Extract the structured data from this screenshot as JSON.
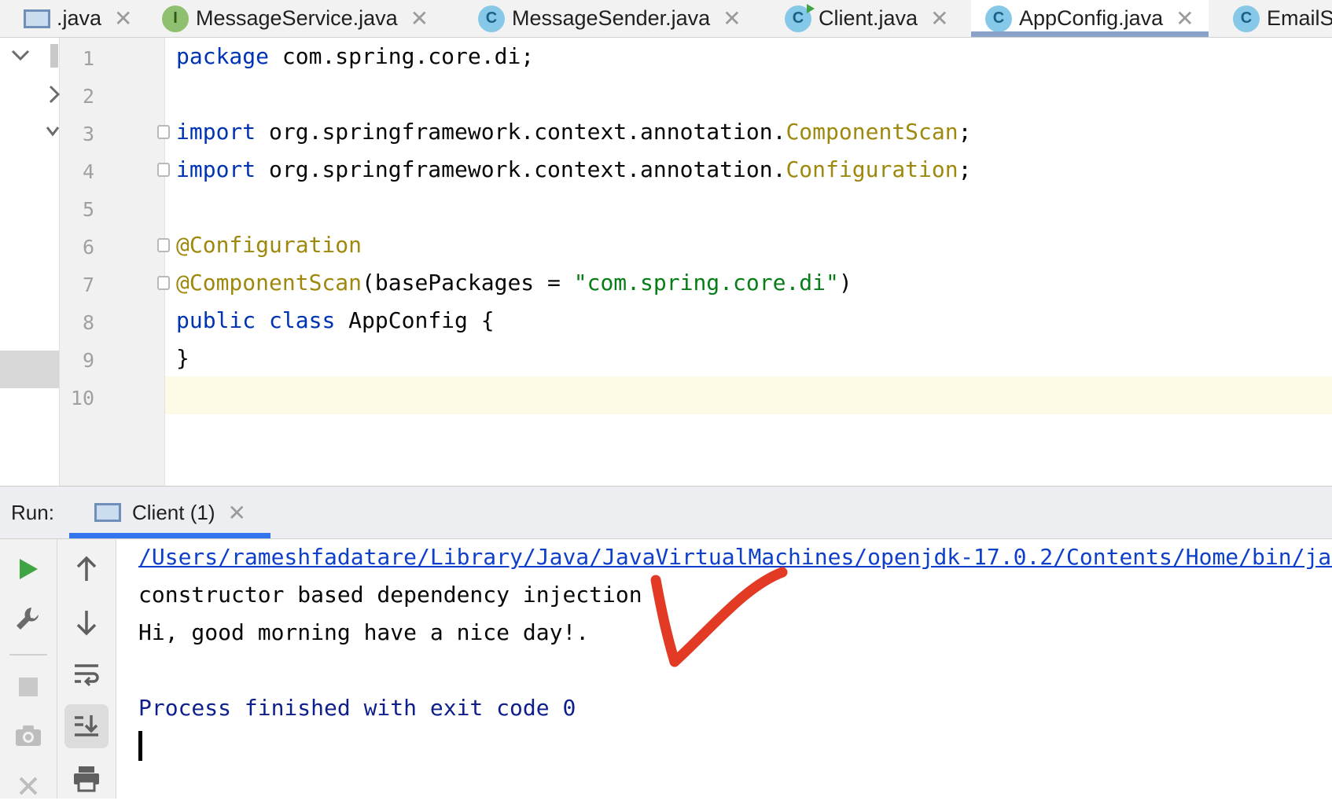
{
  "tabs": [
    {
      "label": ".java",
      "icon": "frame-icon",
      "letter": ""
    },
    {
      "label": "MessageService.java",
      "icon": "interface-icon",
      "letter": "I"
    },
    {
      "label": "MessageSender.java",
      "icon": "class-icon",
      "letter": "C"
    },
    {
      "label": "Client.java",
      "icon": "runnable-class-icon",
      "letter": "C"
    },
    {
      "label": "AppConfig.java",
      "icon": "class-icon",
      "letter": "C",
      "active": true
    },
    {
      "label": "EmailS",
      "icon": "class-icon",
      "letter": "C"
    }
  ],
  "close_glyph": "✕",
  "editor": {
    "line_numbers": [
      "1",
      "2",
      "3",
      "4",
      "5",
      "6",
      "7",
      "8",
      "9",
      "10"
    ],
    "lines": [
      {
        "kw1": "package",
        "text": " com.spring.core.di;"
      },
      {},
      {
        "kw1": "import",
        "text": " org.springframework.context.annotation.",
        "type": "ComponentScan",
        "end": ";"
      },
      {
        "kw1": "import",
        "text": " org.springframework.context.annotation.",
        "type": "Configuration",
        "end": ";"
      },
      {},
      {
        "ann": "@Configuration"
      },
      {
        "ann": "@ComponentScan",
        "text": "(basePackages = ",
        "str": "\"com.spring.core.di\"",
        "end": ")"
      },
      {
        "kw1": "public",
        "kw2": "class",
        "text": " AppConfig {"
      },
      {
        "text": "}"
      }
    ]
  },
  "run_panel": {
    "label": "Run:",
    "tab_label": "Client (1)",
    "console": {
      "command_path": "/Users/rameshfadatare/Library/Java/JavaVirtualMachines/openjdk-17.0.2/Contents/Home/bin/java",
      "output_lines": [
        "constructor based dependency injection",
        "Hi, good morning have a nice day!."
      ],
      "process_line": "Process finished with exit code 0"
    }
  },
  "colors": {
    "keyword": "#0033b3",
    "annotation": "#9e880d",
    "string": "#067d17",
    "link": "#0e3fcb",
    "checkmark": "#e23a24",
    "run_green": "#3fa544"
  }
}
